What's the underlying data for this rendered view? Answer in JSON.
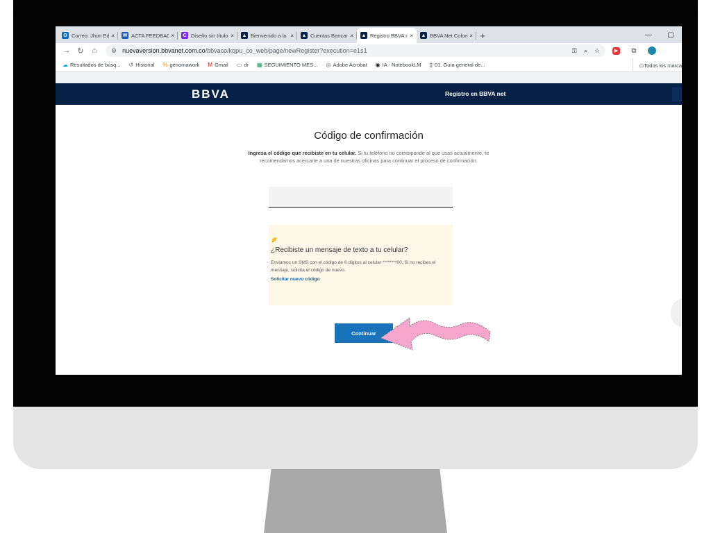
{
  "browser": {
    "tabs": [
      {
        "label": "Correo: Jhon Ed",
        "icon": "outlook-icon",
        "color": "#0f6cbd",
        "glyph": "O",
        "active": false
      },
      {
        "label": "ACTA FEEDBACK",
        "icon": "word-icon",
        "color": "#185abd",
        "glyph": "W",
        "active": false
      },
      {
        "label": "Diseño sin título",
        "icon": "canva-icon",
        "color": "#7d2ae8",
        "glyph": "C",
        "active": false
      },
      {
        "label": "Bienvenido a la",
        "icon": "bbva-icon",
        "color": "#072146",
        "glyph": "▲",
        "active": false
      },
      {
        "label": "Cuentas Bancar",
        "icon": "bbva-icon",
        "color": "#072146",
        "glyph": "▲",
        "active": false
      },
      {
        "label": "Registro BBVA n",
        "icon": "bbva-icon",
        "color": "#072146",
        "glyph": "▲",
        "active": true
      },
      {
        "label": "BBVA Net Colom",
        "icon": "bbva-icon",
        "color": "#072146",
        "glyph": "▲",
        "active": false
      }
    ],
    "tab_close": "×",
    "new_tab": "+",
    "window_controls": {
      "minimize": "—",
      "restore": "▢"
    },
    "url_host": "nuevaversion.bbvanet.com.co",
    "url_path": "/bbvaco/kqpu_co_web/page/newRegister?execution=e1s1",
    "bookmarks": [
      {
        "label": "Resultados de búsq...",
        "icon": "salesforce-icon",
        "glyph": "☁"
      },
      {
        "label": "Historial",
        "icon": "history-icon",
        "glyph": "↺"
      },
      {
        "label": "genomawork",
        "icon": "genomawork-icon",
        "glyph": "%"
      },
      {
        "label": "Gmail",
        "icon": "gmail-icon",
        "glyph": "M"
      },
      {
        "label": "dr",
        "icon": "folder-icon",
        "glyph": "▭"
      },
      {
        "label": "SEGUIMIENTO MES...",
        "icon": "sheets-icon",
        "glyph": "▦"
      },
      {
        "label": "Adobe Acrobat",
        "icon": "acrobat-icon",
        "glyph": "◎"
      },
      {
        "label": "IA - NotebookLM",
        "icon": "notebooklm-icon",
        "glyph": "◉"
      },
      {
        "label": "01. Guía general de...",
        "icon": "notion-icon",
        "glyph": "▯"
      }
    ],
    "bookmarks_right": "Todos los marca"
  },
  "page": {
    "logo": "BBVA",
    "header_title": "Registro en BBVA net",
    "title": "Código de confirmación",
    "instructions_bold": "Ingresa el código que recibiste en tu celular.",
    "instructions_rest": " Si tu teléfono no corresponde al que usas actualmente, te recomendamos acercarte a una de nuestras oficinas para continuar el proceso de confirmación.",
    "code_input_value": "",
    "sms_card": {
      "title": "¿Recibiste un mensaje de texto a tu celular?",
      "body": "Enviamos un SMS con el código de 6 dígitos al celular ********00. Si no recibes el mensaje, solicita el código de nuevo.",
      "link": "Solicitar nuevo código"
    },
    "continue_label": "Continuar"
  },
  "colors": {
    "bbva_navy": "#072146",
    "button_blue": "#1973b8",
    "sms_card_bg": "#fdf8e7",
    "arrow_pink": "#f4a6cc"
  }
}
